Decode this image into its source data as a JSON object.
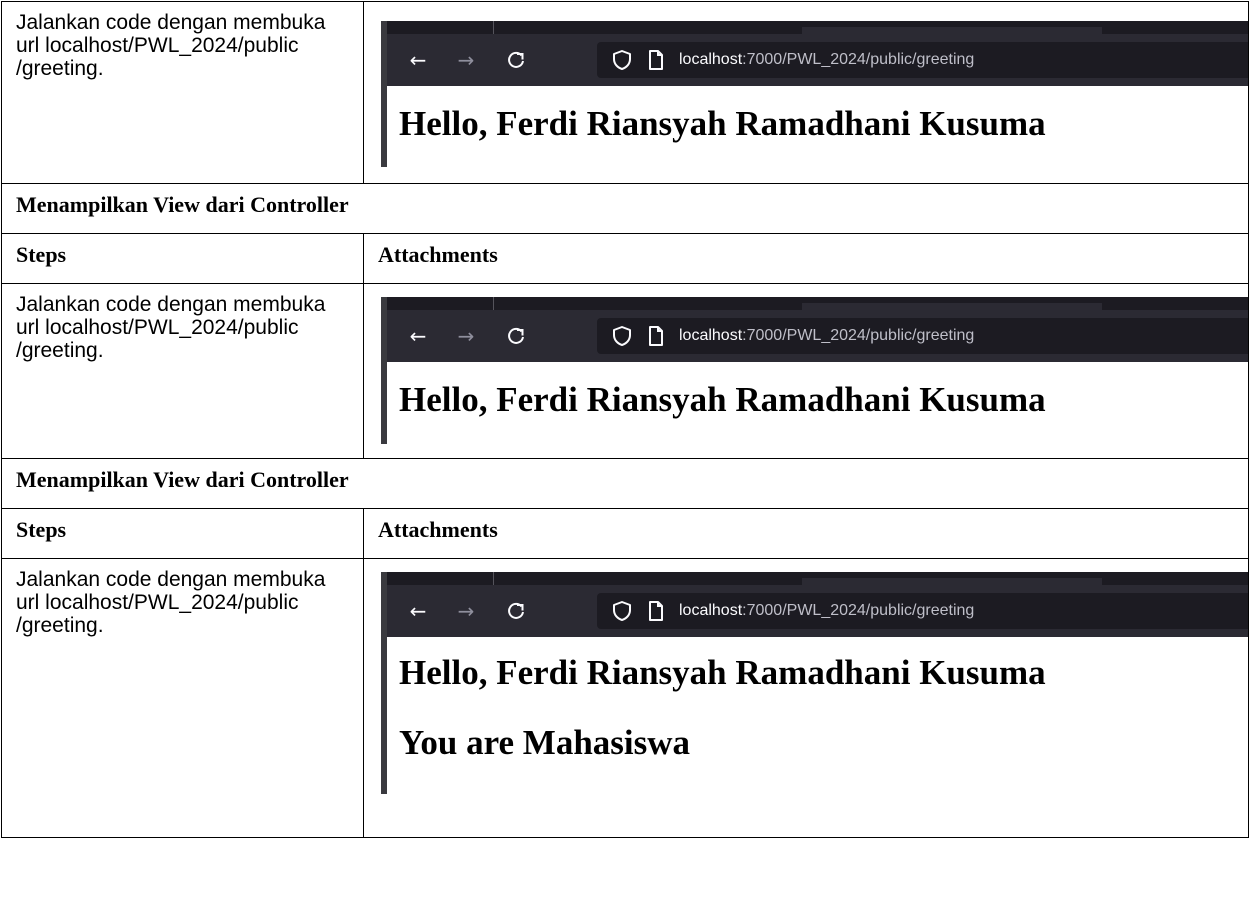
{
  "rows": {
    "step_text_1": "Jalankan code dengan membuka url localhost/PWL_2024/public /greeting.",
    "section_1": "Menampilkan View dari Controller",
    "steps_header_1": "Steps",
    "attachments_header_1": "Attachments",
    "step_text_2": "Jalankan code dengan membuka url localhost/PWL_2024/public /greeting.",
    "section_2": "Menampilkan View dari Controller",
    "steps_header_2": "Steps",
    "attachments_header_2": "Attachments",
    "step_text_3": "Jalankan code dengan membuka url localhost/PWL_2024/public /greeting."
  },
  "browser": {
    "url_host": "localhost",
    "url_path": ":7000/PWL_2024/public/greeting",
    "back_icon": "arrow-left-icon",
    "forward_icon": "arrow-right-icon",
    "reload_icon": "reload-icon",
    "shield_icon": "shield-icon",
    "page_icon": "page-icon",
    "toolbar_color": "#2b2a33",
    "urlbar_color": "#1c1b22"
  },
  "page": {
    "greeting": "Hello, Ferdi Riansyah Ramadhani Kusuma",
    "role": "You are Mahasiswa"
  }
}
